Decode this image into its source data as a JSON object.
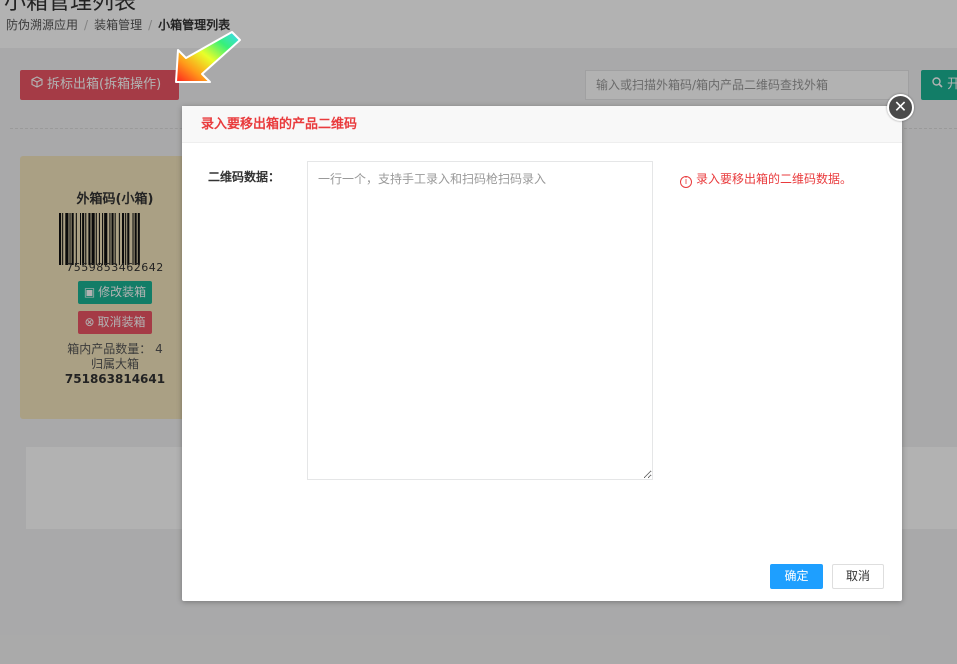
{
  "page": {
    "title": "小箱管理列表",
    "breadcrumb": [
      "防伪溯源应用",
      "装箱管理",
      "小箱管理列表"
    ]
  },
  "toolbar": {
    "split_button_label": "拆标出箱(拆箱操作)",
    "split_button_icon": "cube-icon",
    "search_placeholder": "输入或扫描外箱码/箱内产品二维码查找外箱",
    "search_button_label": "开",
    "search_button_icon": "search-icon"
  },
  "box_card": {
    "title": "外箱码(小箱)",
    "barcode_number": "7559853462642",
    "edit_button_label": "修改装箱",
    "cancel_button_label": "取消装箱",
    "product_count_label": "箱内产品数量：",
    "product_count_value": "4",
    "parent_box_label": "归属大箱",
    "parent_box_number": "751863814641"
  },
  "modal": {
    "title": "录入要移出箱的产品二维码",
    "field_label": "二维码数据：",
    "textarea_placeholder": "一行一个，支持手工录入和扫码枪扫码录入",
    "textarea_value": "",
    "hint": "录入要移出箱的二维码数据。",
    "confirm_label": "确定",
    "cancel_label": "取消",
    "close_icon": "close-icon"
  },
  "colors": {
    "danger": "#ed5565",
    "success": "#1ab394",
    "primary": "#1e9fff",
    "modal_title": "#e93b3d",
    "card_bg": "#f4e6bd"
  }
}
